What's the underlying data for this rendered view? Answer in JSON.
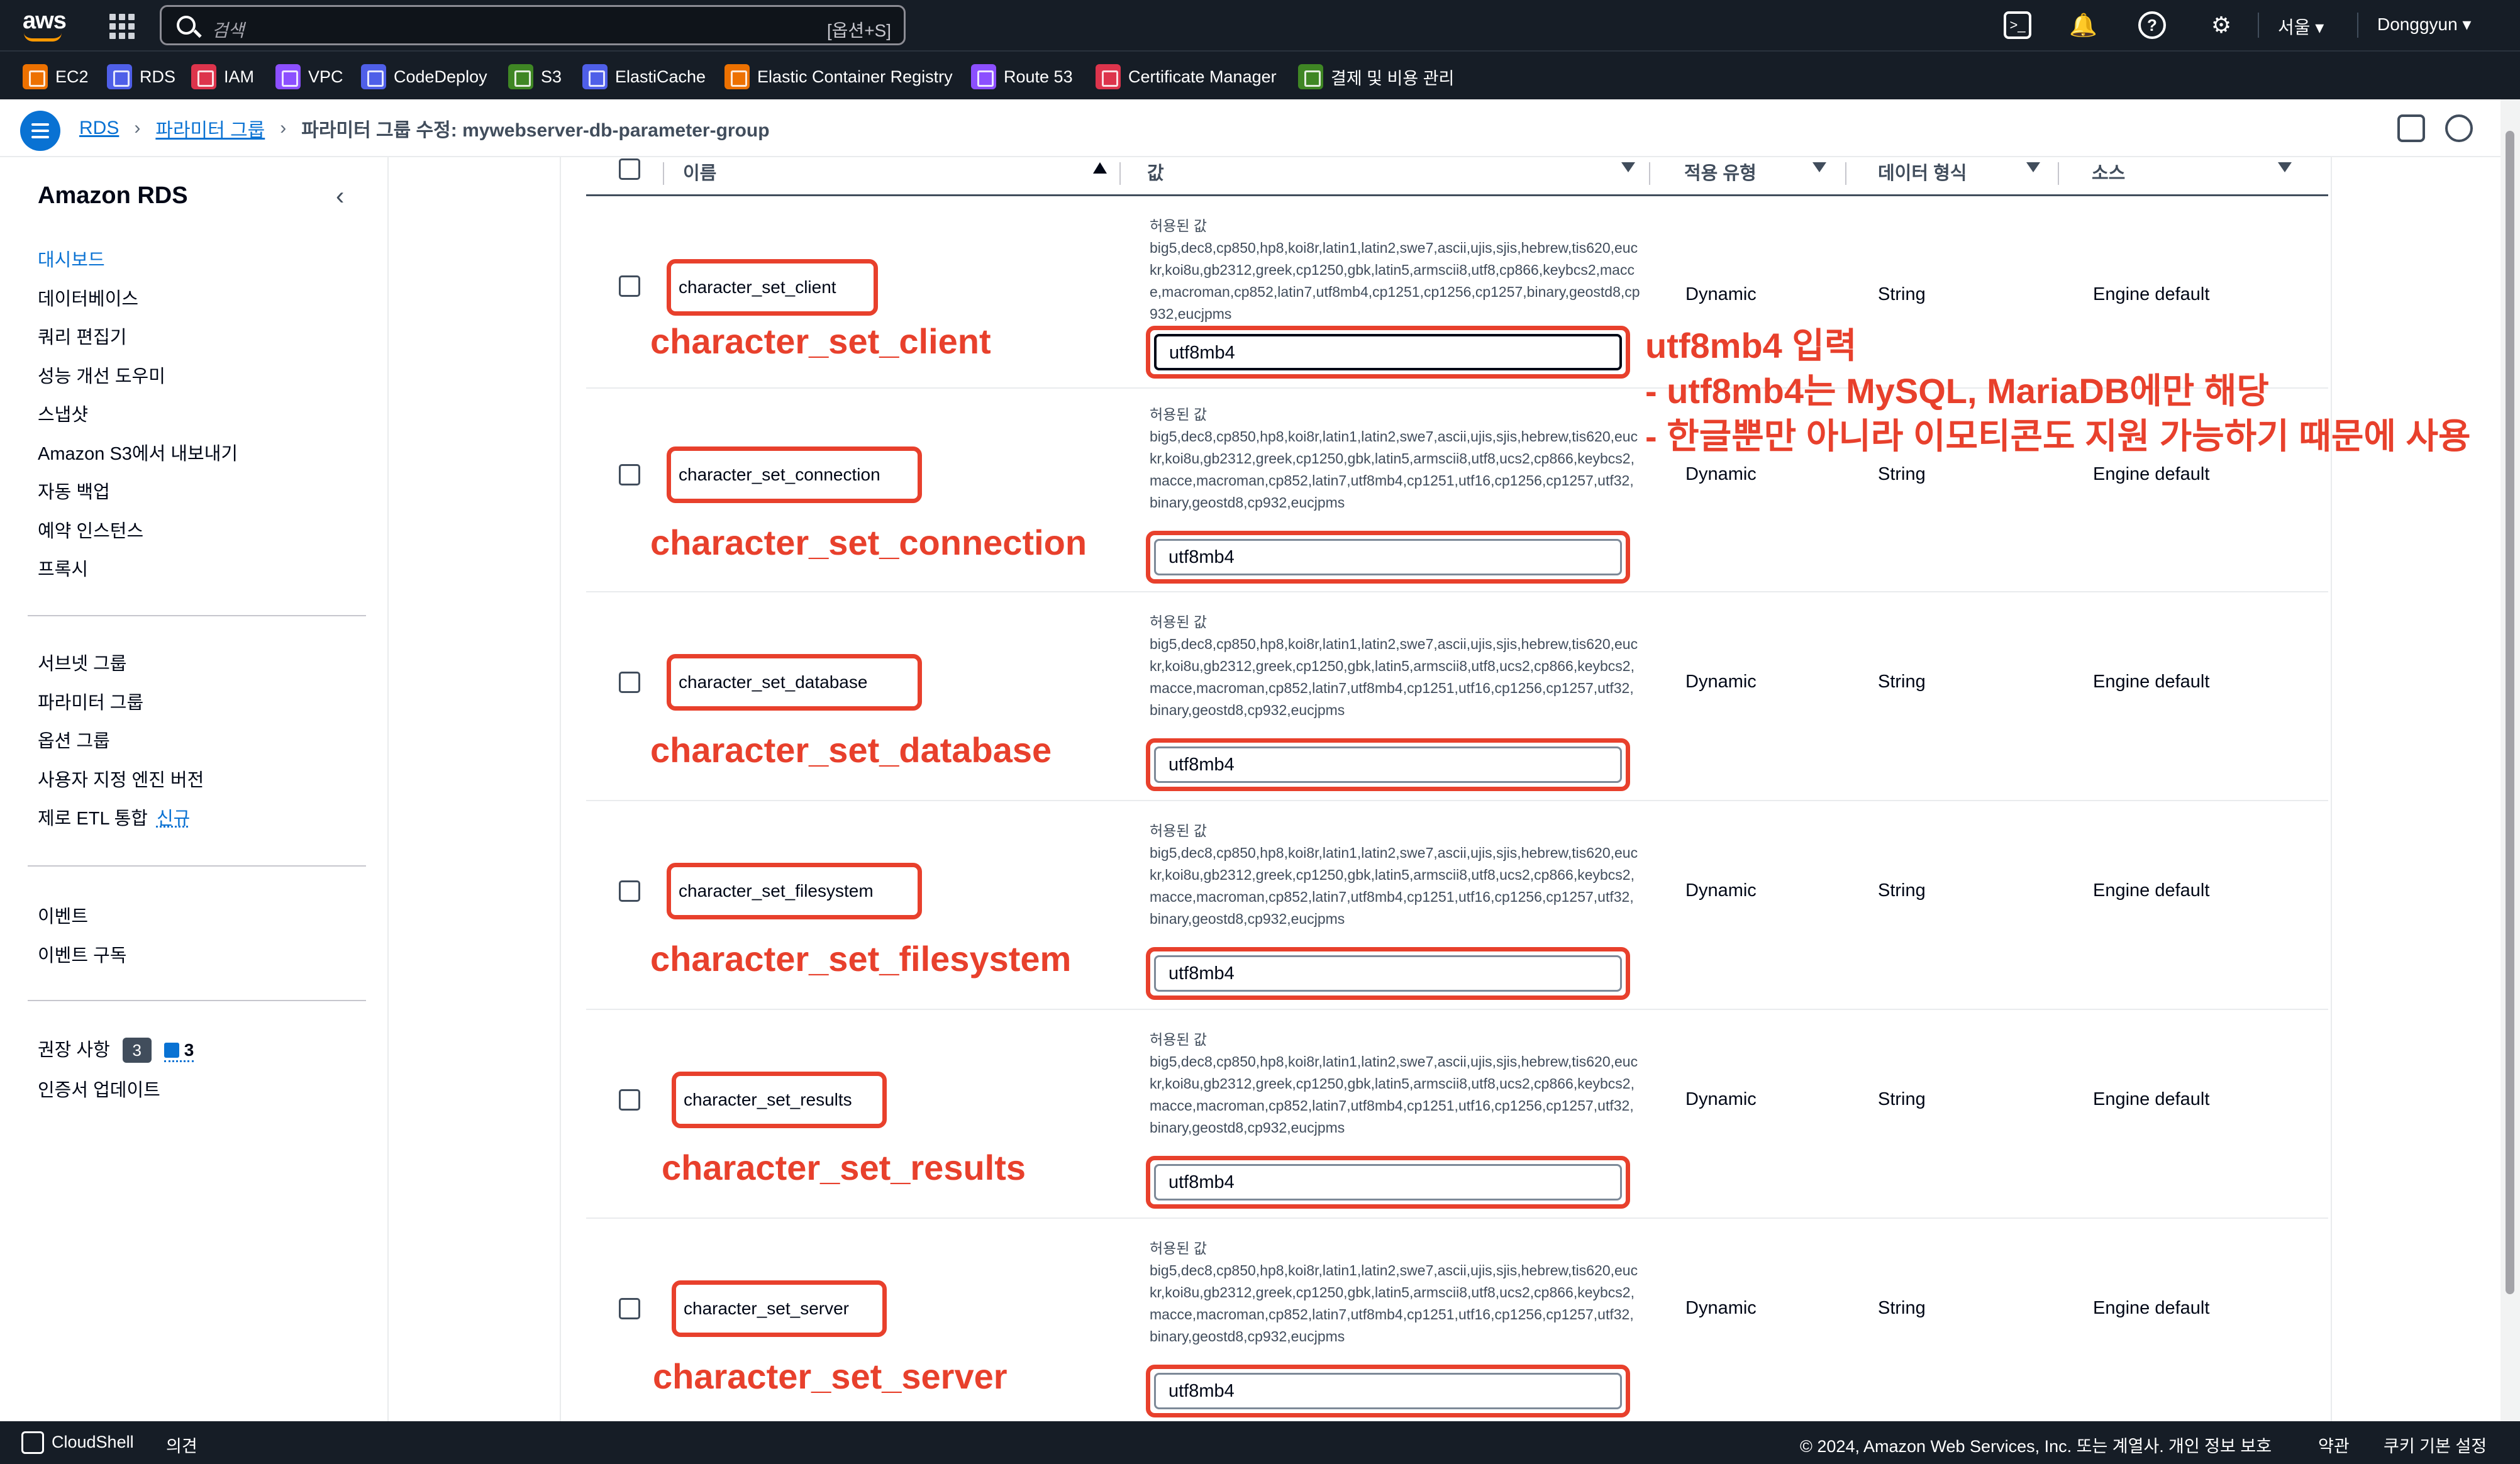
{
  "topnav": {
    "logo": "aws",
    "search_placeholder": "검색",
    "search_shortcut": "[옵션+S]",
    "region": "서울",
    "user": "Donggyun"
  },
  "favorites": [
    {
      "label": "EC2",
      "color": "#ed7100"
    },
    {
      "label": "RDS",
      "color": "#4f5fe8"
    },
    {
      "label": "IAM",
      "color": "#dd344c"
    },
    {
      "label": "VPC",
      "color": "#8c4fff"
    },
    {
      "label": "CodeDeploy",
      "color": "#4f5fe8"
    },
    {
      "label": "S3",
      "color": "#3f8624"
    },
    {
      "label": "ElastiCache",
      "color": "#4f5fe8"
    },
    {
      "label": "Elastic Container Registry",
      "color": "#ed7100"
    },
    {
      "label": "Route 53",
      "color": "#8c4fff"
    },
    {
      "label": "Certificate Manager",
      "color": "#dd344c"
    },
    {
      "label": "결제 및 비용 관리",
      "color": "#3f8624"
    }
  ],
  "breadcrumb": {
    "rds": "RDS",
    "param_groups": "파라미터 그룹",
    "current": "파라미터 그룹 수정: mywebserver-db-parameter-group"
  },
  "sidebar": {
    "title": "Amazon RDS",
    "group1": [
      "대시보드",
      "데이터베이스",
      "쿼리 편집기",
      "성능 개선 도우미",
      "스냅샷",
      "Amazon S3에서 내보내기",
      "자동 백업",
      "예약 인스턴스",
      "프록시"
    ],
    "group2": [
      "서브넷 그룹",
      "파라미터 그룹",
      "옵션 그룹",
      "사용자 지정 엔진 버전",
      "제로 ETL 통합"
    ],
    "new_label": "신규",
    "group3": [
      "이벤트",
      "이벤트 구독"
    ],
    "recommendations": "권장 사항",
    "rec_count_a": "3",
    "rec_count_b": "3",
    "cert_update": "인증서 업데이트"
  },
  "table": {
    "headers": {
      "name": "이름",
      "value": "값",
      "apply_type": "적용 유형",
      "data_type": "데이터 형식",
      "source": "소스"
    },
    "rows": [
      {
        "name": "character_set_client",
        "allowed_label": "허용된 값",
        "allowed": "big5,dec8,cp850,hp8,koi8r,latin1,latin2,swe7,ascii,ujis,sjis,hebrew,tis620,euckr,koi8u,gb2312,greek,cp1250,gbk,latin5,armscii8,utf8,cp866,keybcs2,macce,macroman,cp852,latin7,utf8mb4,cp1251,cp1256,cp1257,binary,geostd8,cp932,eucjpms",
        "value": "utf8mb4",
        "apply_type": "Dynamic",
        "data_type": "String",
        "source": "Engine default"
      },
      {
        "name": "character_set_connection",
        "allowed_label": "허용된 값",
        "allowed": "big5,dec8,cp850,hp8,koi8r,latin1,latin2,swe7,ascii,ujis,sjis,hebrew,tis620,euckr,koi8u,gb2312,greek,cp1250,gbk,latin5,armscii8,utf8,ucs2,cp866,keybcs2,macce,macroman,cp852,latin7,utf8mb4,cp1251,utf16,cp1256,cp1257,utf32,binary,geostd8,cp932,eucjpms",
        "value": "utf8mb4",
        "apply_type": "Dynamic",
        "data_type": "String",
        "source": "Engine default"
      },
      {
        "name": "character_set_database",
        "allowed_label": "허용된 값",
        "allowed": "big5,dec8,cp850,hp8,koi8r,latin1,latin2,swe7,ascii,ujis,sjis,hebrew,tis620,euckr,koi8u,gb2312,greek,cp1250,gbk,latin5,armscii8,utf8,ucs2,cp866,keybcs2,macce,macroman,cp852,latin7,utf8mb4,cp1251,utf16,cp1256,cp1257,utf32,binary,geostd8,cp932,eucjpms",
        "value": "utf8mb4",
        "apply_type": "Dynamic",
        "data_type": "String",
        "source": "Engine default"
      },
      {
        "name": "character_set_filesystem",
        "allowed_label": "허용된 값",
        "allowed": "big5,dec8,cp850,hp8,koi8r,latin1,latin2,swe7,ascii,ujis,sjis,hebrew,tis620,euckr,koi8u,gb2312,greek,cp1250,gbk,latin5,armscii8,utf8,ucs2,cp866,keybcs2,macce,macroman,cp852,latin7,utf8mb4,cp1251,utf16,cp1256,cp1257,utf32,binary,geostd8,cp932,eucjpms",
        "value": "utf8mb4",
        "apply_type": "Dynamic",
        "data_type": "String",
        "source": "Engine default"
      },
      {
        "name": "character_set_results",
        "allowed_label": "허용된 값",
        "allowed": "big5,dec8,cp850,hp8,koi8r,latin1,latin2,swe7,ascii,ujis,sjis,hebrew,tis620,euckr,koi8u,gb2312,greek,cp1250,gbk,latin5,armscii8,utf8,ucs2,cp866,keybcs2,macce,macroman,cp852,latin7,utf8mb4,cp1251,utf16,cp1256,cp1257,utf32,binary,geostd8,cp932,eucjpms",
        "value": "utf8mb4",
        "apply_type": "Dynamic",
        "data_type": "String",
        "source": "Engine default"
      },
      {
        "name": "character_set_server",
        "allowed_label": "허용된 값",
        "allowed": "big5,dec8,cp850,hp8,koi8r,latin1,latin2,swe7,ascii,ujis,sjis,hebrew,tis620,euckr,koi8u,gb2312,greek,cp1250,gbk,latin5,armscii8,utf8,ucs2,cp866,keybcs2,macce,macroman,cp852,latin7,utf8mb4,cp1251,utf16,cp1256,cp1257,utf32,binary,geostd8,cp932,eucjpms",
        "value": "utf8mb4",
        "apply_type": "Dynamic",
        "data_type": "String",
        "source": "Engine default"
      }
    ]
  },
  "annotation": {
    "line1": "utf8mb4 입력",
    "line2": "- utf8mb4는 MySQL, MariaDB에만 해당",
    "line3": "- 한글뿐만 아니라 이모티콘도 지원 가능하기 때문에 사용"
  },
  "footer": {
    "cloudshell": "CloudShell",
    "feedback": "의견",
    "copyright": "© 2024, Amazon Web Services, Inc. 또는 계열사.",
    "privacy": "개인 정보 보호",
    "terms": "약관",
    "cookies": "쿠키 기본 설정"
  },
  "colors": {
    "annotation_red": "#e8402c",
    "nav_bg": "#161d26",
    "link_blue": "#0972d3"
  }
}
